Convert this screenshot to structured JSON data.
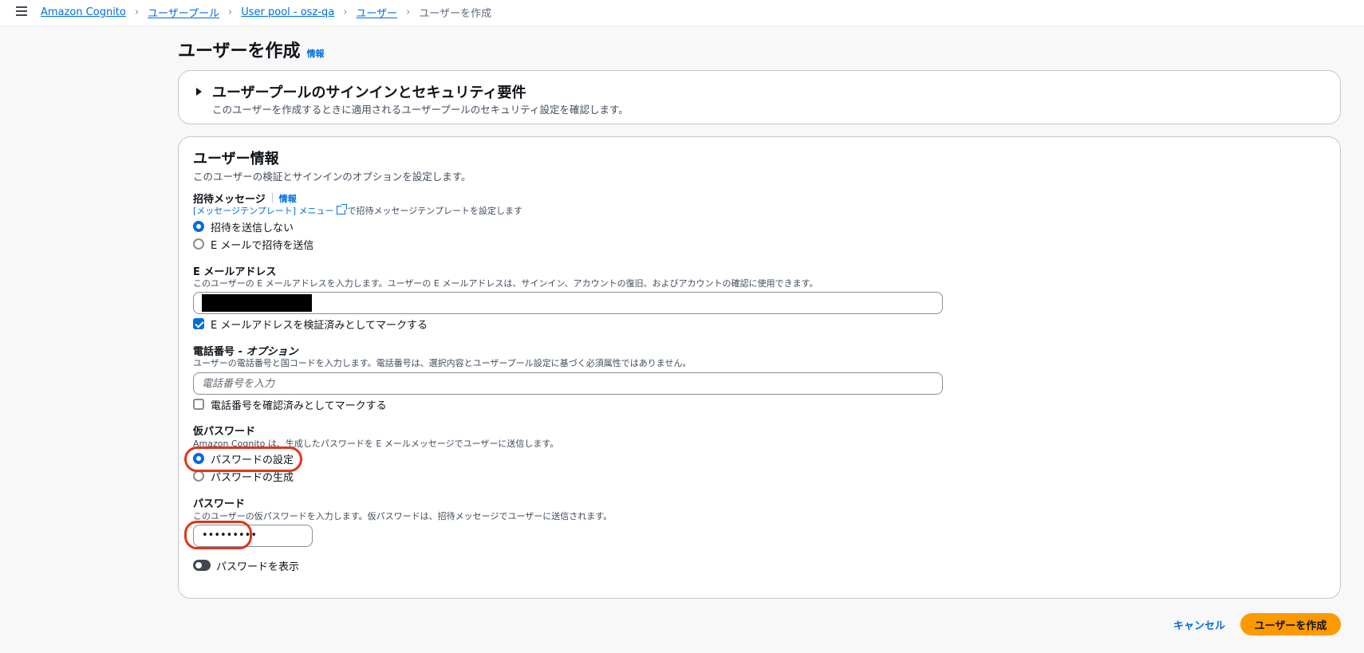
{
  "breadcrumb": [
    "Amazon Cognito",
    "ユーザープール",
    "User pool - osz-qa",
    "ユーザー",
    "ユーザーを作成"
  ],
  "page": {
    "title": "ユーザーを作成",
    "info": "情報"
  },
  "security_panel": {
    "title": "ユーザープールのサインインとセキュリティ要件",
    "description": "このユーザーを作成するときに適用されるユーザープールのセキュリティ設定を確認します。"
  },
  "user_info": {
    "title": "ユーザー情報",
    "description": "このユーザーの検証とサインインのオプションを設定します。"
  },
  "invitation": {
    "label": "招待メッセージ",
    "info": "情報",
    "template_link": "[メッセージテンプレート] メニュー",
    "template_suffix": "で招待メッセージテンプレートを設定します",
    "options": [
      "招待を送信しない",
      "E メールで招待を送信"
    ],
    "selected": 0
  },
  "email": {
    "label": "E メールアドレス",
    "description": "このユーザーの E メールアドレスを入力します。ユーザーの E メールアドレスは、サインイン、アカウントの復旧、およびアカウントの確認に使用できます。",
    "verified_label": "E メールアドレスを検証済みとしてマークする",
    "verified": true
  },
  "phone": {
    "label_main": "電話番号 - ",
    "label_optional": "オプション",
    "description": "ユーザーの電話番号と国コードを入力します。電話番号は、選択内容とユーザープール設定に基づく必須属性ではありません。",
    "placeholder": "電話番号を入力",
    "verified_label": "電話番号を確認済みとしてマークする",
    "verified": false
  },
  "temp_password": {
    "label": "仮パスワード",
    "description": "Amazon Cognito は、生成したパスワードを E メールメッセージでユーザーに送信します。",
    "options": [
      "パスワードの設定",
      "パスワードの生成"
    ],
    "selected": 0
  },
  "password": {
    "label": "パスワード",
    "description": "このユーザーの仮パスワードを入力します。仮パスワードは、招待メッセージでユーザーに送信されます。",
    "value": "•••••••••",
    "show_label": "パスワードを表示",
    "show": false
  },
  "actions": {
    "cancel": "キャンセル",
    "create": "ユーザーを作成"
  },
  "colors": {
    "link": "#006ce0",
    "primary_button": "#ff9900",
    "annotation": "#e0351d"
  }
}
